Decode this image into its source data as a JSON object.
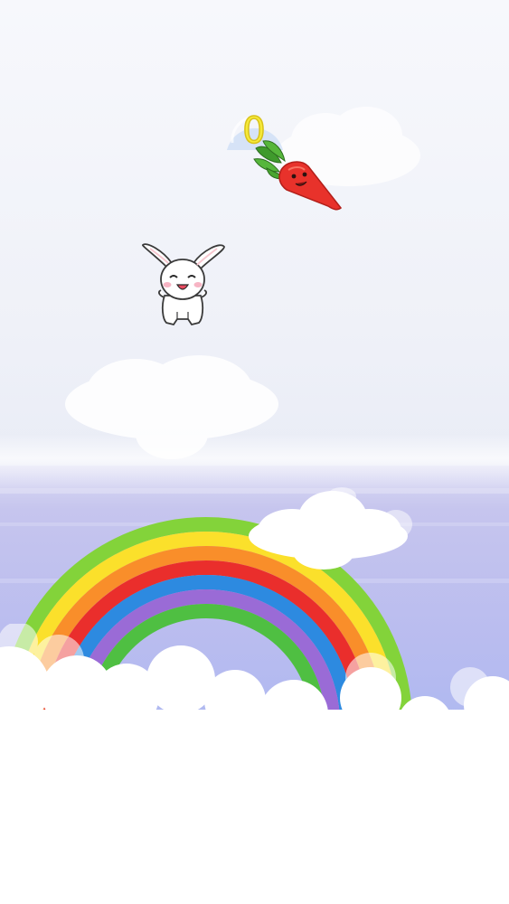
{
  "game": {
    "score": "0",
    "colors": {
      "sky_top": "#f6f7fc",
      "sky_mid": "#eef0f9",
      "sea_top": "#c7c6ef",
      "sea_bottom": "#a2b3f3",
      "cloud": "#ffffff",
      "score": "#f6ea3a",
      "rainbow": [
        "#83d33a",
        "#fbe02b",
        "#f98e2a",
        "#ea2e2c",
        "#2d8ae0",
        "#9a6bd6",
        "#4fbf42"
      ]
    },
    "characters": {
      "player": "bunny",
      "target": "carrot"
    },
    "icons": [
      "bunny-icon",
      "carrot-icon",
      "bubble-icon",
      "rainbow-icon",
      "cloud-icon"
    ]
  }
}
